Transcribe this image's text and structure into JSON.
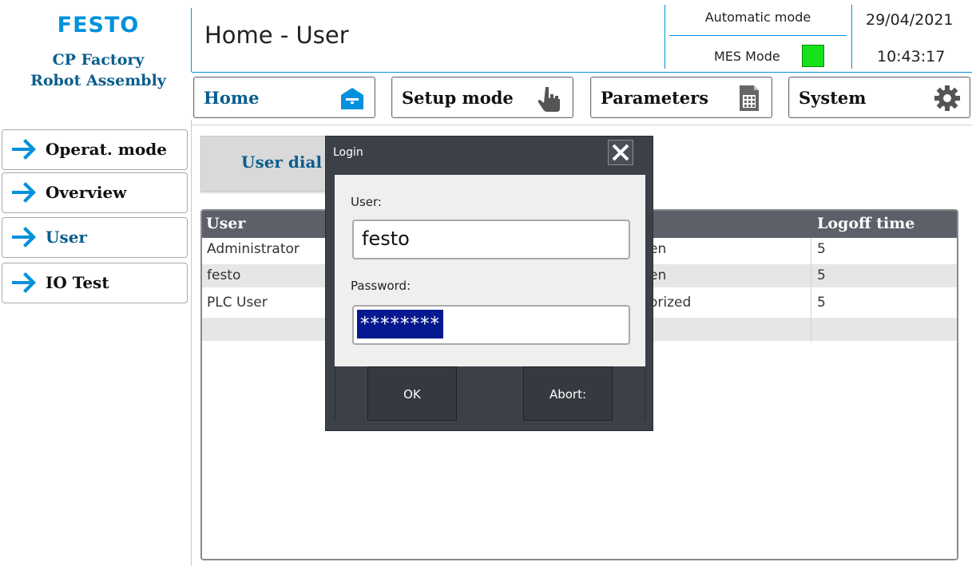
{
  "header": {
    "brand": "FESTO",
    "station_line1": "CP Factory",
    "station_line2": "Robot Assembly",
    "page_title": "Home - User",
    "mode": "Automatic mode",
    "mes_mode_label": "MES Mode",
    "mes_indicator_color": "#17e01c",
    "date": "29/04/2021",
    "time": "10:43:17"
  },
  "top_nav": [
    {
      "label": "Home",
      "icon": "house-icon"
    },
    {
      "label": "Setup mode",
      "icon": "hand-pointer-icon"
    },
    {
      "label": "Parameters",
      "icon": "document-calculator-icon"
    },
    {
      "label": "System",
      "icon": "gear-icon"
    }
  ],
  "side_nav": [
    {
      "label": "Operat. mode",
      "icon": "arrow-right-icon"
    },
    {
      "label": "Overview",
      "icon": "arrow-right-icon"
    },
    {
      "label": "User",
      "icon": "arrow-right-icon"
    },
    {
      "label": "IO Test",
      "icon": "arrow-right-icon"
    }
  ],
  "user_dialog_tab": {
    "label": "User dial"
  },
  "table": {
    "headers": {
      "user": "User",
      "logoff": "Logoff time"
    },
    "rows": [
      {
        "user": "Administrator",
        "group": "en",
        "logoff": "5"
      },
      {
        "user": "festo",
        "group": "en",
        "logoff": "5"
      },
      {
        "user": "PLC User",
        "group": "orized",
        "logoff": "5"
      }
    ]
  },
  "login_dialog": {
    "title": "Login",
    "user_label": "User:",
    "user_value": "festo",
    "password_label": "Password:",
    "password_value": "********",
    "ok_label": "OK",
    "abort_label": "Abort:"
  },
  "colors": {
    "accent": "#0091dc",
    "brand_dark": "#0a5e8d",
    "table_header": "#5d6069",
    "dialog_bg": "#3c4149",
    "password_selection": "#06188f"
  }
}
